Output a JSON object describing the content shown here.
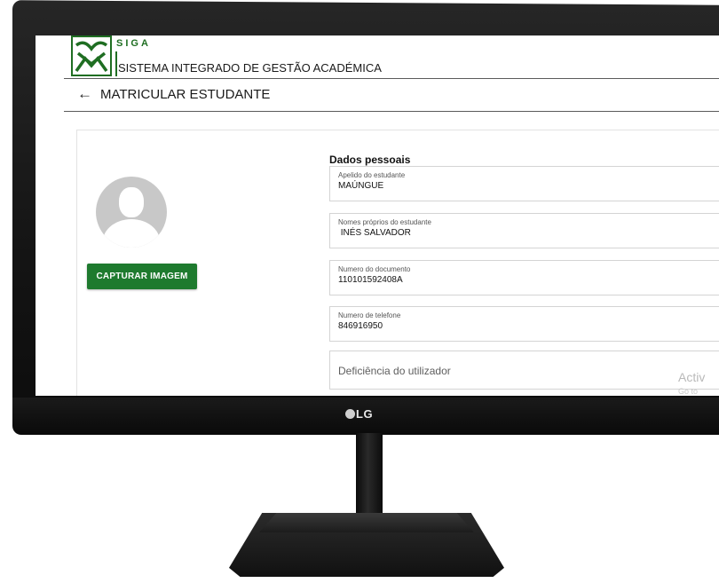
{
  "header": {
    "brand": "SIGA",
    "subtitle": "SISTEMA INTEGRADO DE GESTÃO ACADÉMICA",
    "logo_color": "#1f6e22"
  },
  "page": {
    "back_icon": "arrow-left-icon",
    "title": "MATRICULAR ESTUDANTE"
  },
  "photo": {
    "capture_label": "CAPTURAR IMAGEM",
    "button_color": "#1e7a2e"
  },
  "form": {
    "section_title": "Dados pessoais",
    "fields": [
      {
        "label": "Apelido do estudante",
        "value": "MAÚNGUE"
      },
      {
        "label": "Nomes próprios do estudante",
        "value": " INÉS SALVADOR"
      },
      {
        "label": "Numero do documento",
        "value": "110101592408A"
      },
      {
        "label": "Numero de telefone",
        "value": "846916950"
      }
    ],
    "disability_placeholder": "Deficiência do utilizador"
  },
  "watermark": {
    "line1": "Activ",
    "line2": "Go to"
  },
  "monitor": {
    "brand": "LG"
  }
}
